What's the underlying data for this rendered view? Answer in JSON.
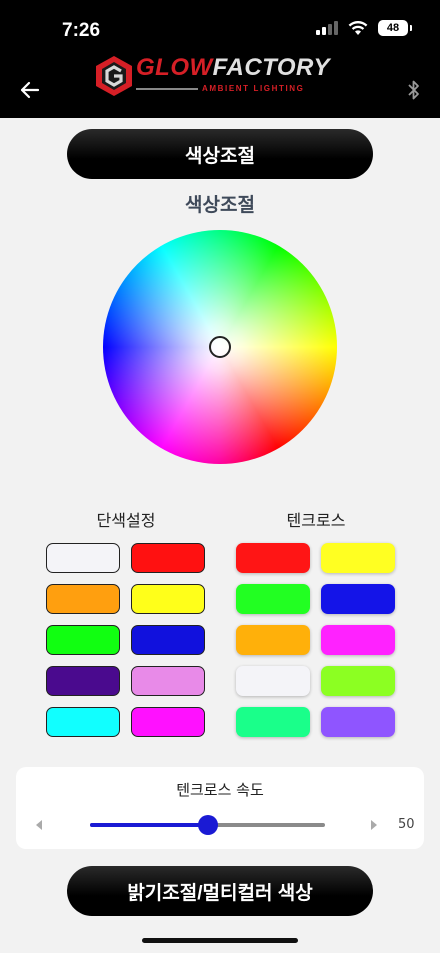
{
  "status": {
    "time": "7:26",
    "battery": "48"
  },
  "header": {
    "logo_main_a": "GLOW",
    "logo_main_b": "FACTORY",
    "logo_sub": "AMBIENT LIGHTING"
  },
  "top_button": "색상조절",
  "section_title": "색상조절",
  "solid_section": {
    "label": "단색설정",
    "colors": [
      "#f4f4f8",
      "#ff1111",
      "#ff9f0f",
      "#ffff1a",
      "#11ff11",
      "#1111dd",
      "#4a0a8e",
      "#e88ae8",
      "#11ffff",
      "#ff11ff"
    ]
  },
  "flash_section": {
    "label": "텐크로스",
    "colors": [
      "#ff1515",
      "#ffff22",
      "#22ff22",
      "#1414e8",
      "#ffb00a",
      "#ff22ff",
      "#f4f4f8",
      "#8cff22",
      "#1aff8a",
      "#8f55ff"
    ]
  },
  "speed": {
    "label": "텐크로스 속도",
    "value": "50",
    "fraction": 0.5
  },
  "bottom_button": "밝기조절/멀티컬러 색상",
  "colors": {
    "pill_bg": "#000000",
    "slider_accent": "#1a1ad4",
    "logo_red": "#d61f26"
  }
}
